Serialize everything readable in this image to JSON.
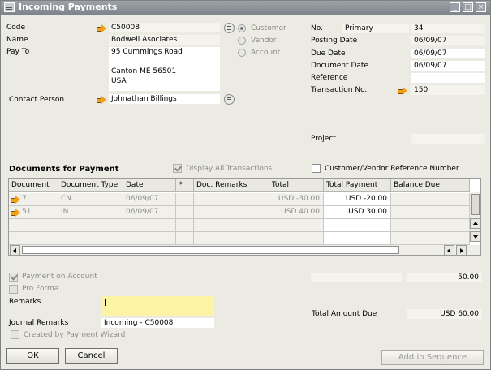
{
  "window": {
    "title": "Incoming Payments",
    "buttons": {
      "minimize": "_",
      "restore": "□",
      "close": "×"
    }
  },
  "header": {
    "code_label": "Code",
    "code_value": "C50008",
    "name_label": "Name",
    "name_value": "Bodwell Asociates",
    "payto_label": "Pay To",
    "payto_lines": [
      "95 Cummings Road",
      "",
      "Canton ME  56501",
      "USA"
    ],
    "contact_label": "Contact Person",
    "contact_value": "Johnathan Billings",
    "type_options": [
      "Customer",
      "Vendor",
      "Account"
    ],
    "selected_type": "Customer"
  },
  "doc_info": {
    "no_label": "No.",
    "series": "Primary",
    "no_value": "34",
    "posting_label": "Posting Date",
    "posting_value": "06/09/07",
    "due_label": "Due Date",
    "due_value": "06/09/07",
    "docdate_label": "Document Date",
    "docdate_value": "06/09/07",
    "reference_label": "Reference",
    "reference_value": "",
    "trans_label": "Transaction No.",
    "trans_value": "150",
    "project_label": "Project",
    "project_value": ""
  },
  "documents": {
    "title": "Documents for Payment",
    "display_all_label": "Display All Transactions",
    "display_all_checked": true,
    "ref_number_label": "Customer/Vendor Reference Number",
    "ref_number_checked": false,
    "columns": [
      "Document",
      "Document Type",
      "Date",
      "*",
      "Doc. Remarks",
      "Total",
      "Total Payment",
      "Balance Due"
    ],
    "rows": [
      {
        "document": "7",
        "type": "CN",
        "date": "06/09/07",
        "star": "",
        "remarks": "",
        "total": "USD -30.00",
        "payment": "USD -20.00",
        "balance": ""
      },
      {
        "document": "51",
        "type": "IN",
        "date": "06/09/07",
        "star": "",
        "remarks": "",
        "total": "USD 40.00",
        "payment": "USD 30.00",
        "balance": ""
      }
    ]
  },
  "footer": {
    "payment_on_account_label": "Payment on Account",
    "payment_on_account_checked": true,
    "payment_on_account_value": "",
    "payment_on_account_amount": "50.00",
    "pro_forma_label": "Pro Forma",
    "pro_forma_checked": false,
    "remarks_label": "Remarks",
    "remarks_value": "",
    "journal_label": "Journal Remarks",
    "journal_value": "Incoming - C50008",
    "wizard_label": "Created by Payment Wizard",
    "total_due_label": "Total Amount Due",
    "total_due_value": "USD 60.00",
    "ok_label": "OK",
    "cancel_label": "Cancel",
    "add_seq_label": "Add in Sequence"
  }
}
